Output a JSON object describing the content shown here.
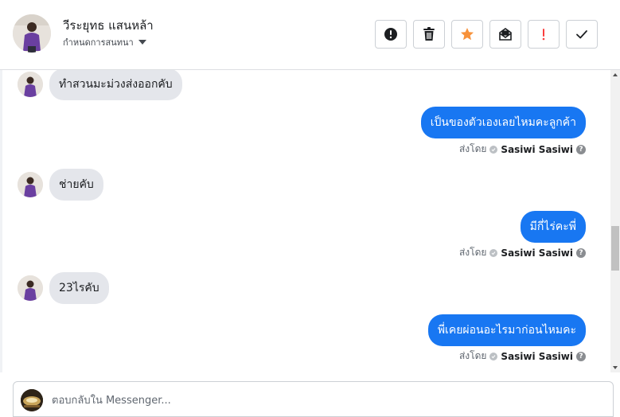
{
  "header": {
    "contact_name": "วีระยุทธ แสนหล้า",
    "assign_label": "กำหนดการสนทนา",
    "actions": [
      {
        "name": "spam",
        "label": "!",
        "icon": "alert-circle-icon"
      },
      {
        "name": "delete",
        "icon": "trash-icon"
      },
      {
        "name": "star",
        "icon": "star-icon",
        "color": "#f7923b"
      },
      {
        "name": "mark-unread",
        "icon": "envelope-open-icon"
      },
      {
        "name": "follow-up",
        "label": "!",
        "icon": "exclamation-icon",
        "color": "#fa3e3e"
      },
      {
        "name": "done",
        "icon": "check-icon"
      }
    ]
  },
  "messages": [
    {
      "direction": "in",
      "text": "ทำสวนมะม่วงส่งออกคับ"
    },
    {
      "direction": "out",
      "text": "เป็นของตัวเองเลยไหมคะลูกค้า",
      "sent_label": "ส่งโดย",
      "sender": "Sasiwi Sasiwi"
    },
    {
      "direction": "in",
      "text": "ช่ายคับ"
    },
    {
      "direction": "out",
      "text": "มีกี่ไร่คะพี่",
      "sent_label": "ส่งโดย",
      "sender": "Sasiwi Sasiwi"
    },
    {
      "direction": "in",
      "text": "23ไรคับ"
    },
    {
      "direction": "out",
      "text": "พี่เคยผ่อนอะไรมาก่อนไหมคะ",
      "sent_label": "ส่งโดย",
      "sender": "Sasiwi Sasiwi"
    }
  ],
  "composer": {
    "placeholder": "ตอบกลับใน Messenger..."
  },
  "colors": {
    "accent": "#1877f2",
    "incoming_bubble": "#e4e6eb",
    "star": "#f7923b",
    "alert": "#fa3e3e"
  }
}
